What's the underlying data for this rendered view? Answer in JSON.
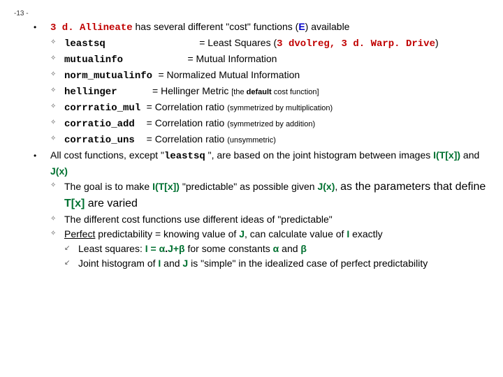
{
  "pageNum": "-13 -",
  "dot": "•",
  "dia": "✧",
  "arrow": "↙",
  "intro": {
    "cmd": "3 d. Allineate",
    "t1": " has several different \"cost\" functions (",
    "E": "E",
    "t2": ") available"
  },
  "funcs": [
    {
      "name": "leastsq",
      "pad": "                ",
      "eq": "= Least Squares (",
      "ref": "3 dvolreg, 3 d. Warp. Drive",
      "tail": ")",
      "note": "",
      "noteEnd": ""
    },
    {
      "name": "mutualinfo",
      "pad": "           ",
      "eq": "= Mutual Information",
      "ref": "",
      "tail": "",
      "note": "",
      "noteEnd": ""
    },
    {
      "name": "norm_mutualinfo",
      "pad": " ",
      "eq": "= Normalized Mutual Information",
      "ref": "",
      "tail": "",
      "note": "",
      "noteEnd": ""
    },
    {
      "name": "hellinger",
      "pad": "      ",
      "eq": "= Hellinger Metric  ",
      "ref": "",
      "tail": "",
      "note": "[the ",
      "noteMid": "default",
      "noteEnd": " cost function]"
    },
    {
      "name": "corrratio_mul",
      "pad": " ",
      "eq": "= Correlation ratio ",
      "ref": "",
      "tail": "",
      "note": "(symmetrized by multiplication)",
      "noteEnd": ""
    },
    {
      "name": "corratio_add",
      "pad": "  ",
      "eq": "= Correlation ratio ",
      "ref": "",
      "tail": "",
      "note": "(symmetrized by addition)",
      "noteEnd": ""
    },
    {
      "name": "corratio_uns",
      "pad": "  ",
      "eq": "= Correlation ratio ",
      "ref": "",
      "tail": "",
      "note": "(unsymmetric)",
      "noteEnd": ""
    }
  ],
  "hist": {
    "t1": "All cost functions, except \"",
    "leastsq": "leastsq",
    "t2": " \", are based on the joint histogram between images ",
    "ITx": "I(T[x])",
    "and": " and ",
    "Jx": "J(x)"
  },
  "goal": {
    "t1": "The goal is to make ",
    "ITx": "I(T[x])",
    "t2": " \"predictable\" as possible given ",
    "Jx": "J(x)",
    "t3": ", ",
    "big": "as the parameters that define ",
    "Tx": "T[x]",
    "t4": " are varied"
  },
  "diffIdeas": "The different cost functions use different ideas of \"predictable\"",
  "perf": {
    "label": "Perfect",
    "t1": " predictability = knowing value of ",
    "J": "J",
    "t2": ", can calculate value of ",
    "I": "I",
    "t3": " exactly"
  },
  "ls": {
    "t1": "Least squares: ",
    "eq": "I = α",
    "dot": ".",
    "eq2": "J+β",
    "t2": " for some constants ",
    "a": "α",
    "and": " and ",
    "b": "β"
  },
  "jh": {
    "t1": "Joint histogram of ",
    "I": "I",
    "and": " and ",
    "J": "J",
    "t2": " is \"simple\" in the idealized case of perfect predictability"
  }
}
